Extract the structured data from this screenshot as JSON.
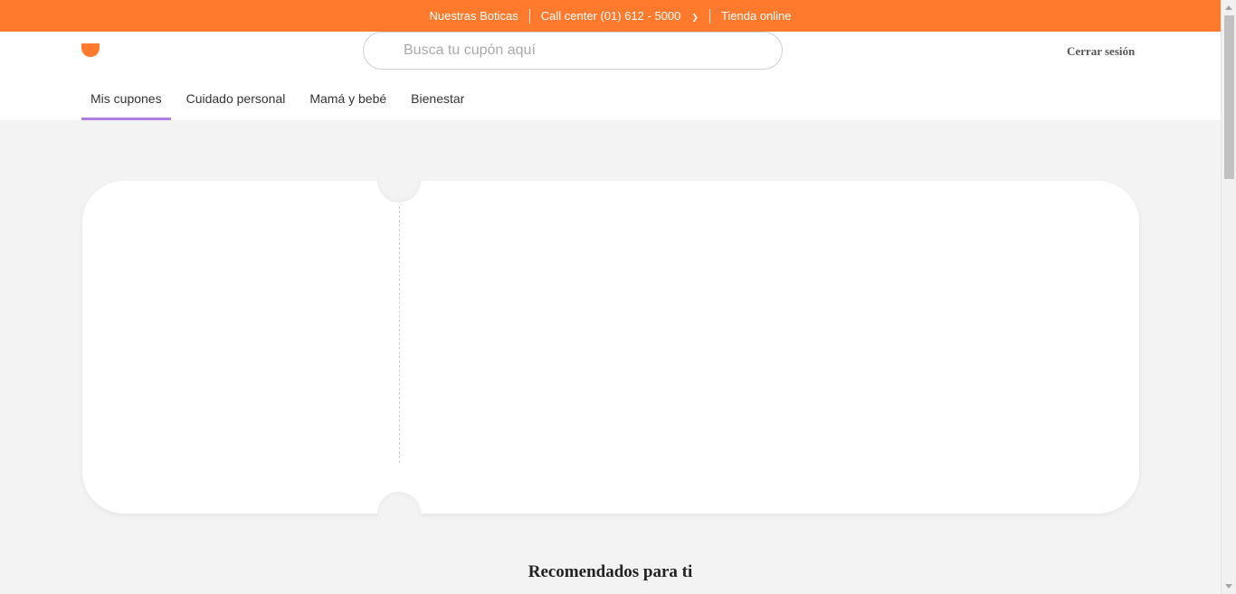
{
  "topbar": {
    "items": [
      {
        "label": "Nuestras Boticas"
      },
      {
        "label": "Call center (01) 612 - 5000"
      },
      {
        "label": "Tienda online"
      }
    ],
    "chevron_icon": "chevron-down-icon"
  },
  "header": {
    "logo_icon": "brand-logo",
    "search": {
      "placeholder": "Busca tu cupón aquí",
      "value": ""
    },
    "logout_label": "Cerrar sesión",
    "tabs": [
      {
        "label": "Mis cupones",
        "active": true
      },
      {
        "label": "Cuidado personal",
        "active": false
      },
      {
        "label": "Mamá y bebé",
        "active": false
      },
      {
        "label": "Bienestar",
        "active": false
      }
    ]
  },
  "main": {
    "recommendations_title": "Recomendados para ti"
  },
  "colors": {
    "brand_orange": "#ff7a2d",
    "active_tab_underline": "#b17fe3",
    "page_background": "#f3f3f3"
  }
}
